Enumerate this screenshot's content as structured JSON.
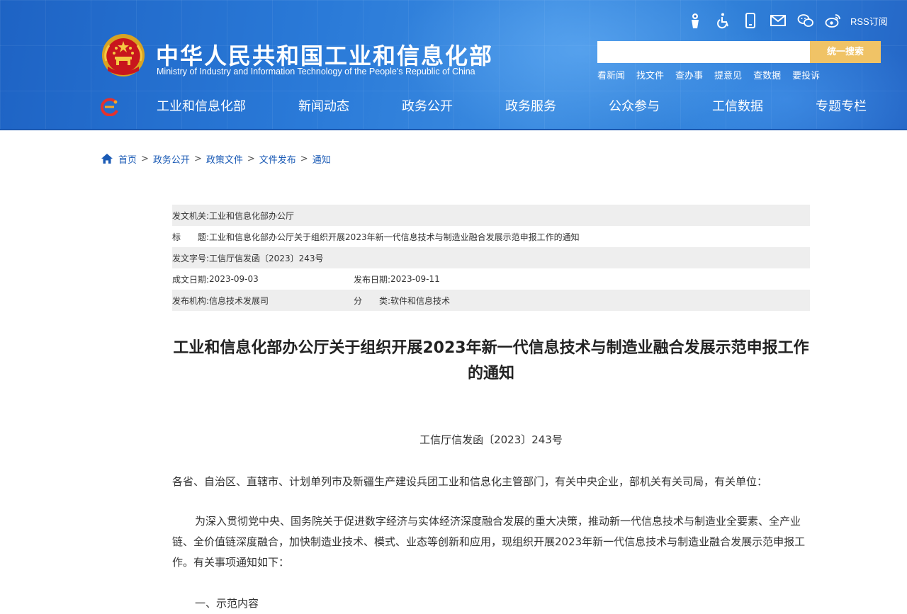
{
  "header": {
    "title_cn": "中华人民共和国工业和信息化部",
    "title_en": "Ministry of Industry and Information Technology of the People's Republic of China",
    "tools": [
      {
        "icon": "elder-mode-icon"
      },
      {
        "icon": "accessibility-icon"
      },
      {
        "icon": "mobile-icon"
      },
      {
        "icon": "mail-icon"
      },
      {
        "icon": "wechat-icon"
      },
      {
        "icon": "weibo-icon"
      }
    ],
    "rss_label": "RSS订阅",
    "search": {
      "placeholder": "",
      "button_label": "统一搜索"
    },
    "quick_links": [
      "看新闻",
      "找文件",
      "查办事",
      "提意见",
      "查数据",
      "要投诉"
    ],
    "nav": [
      "工业和信息化部",
      "新闻动态",
      "政务公开",
      "政务服务",
      "公众参与",
      "工信数据",
      "专题专栏"
    ]
  },
  "breadcrumb": [
    "首页",
    "政务公开",
    "政策文件",
    "文件发布",
    "通知"
  ],
  "breadcrumb_sep": ">",
  "meta": {
    "issuer_key": "发文机关:",
    "issuer": "工业和信息化部办公厅",
    "title_key": "标　　题:",
    "title": "工业和信息化部办公厅关于组织开展2023年新一代信息技术与制造业融合发展示范申报工作的通知",
    "doc_no_key": "发文字号:",
    "doc_no": "工信厅信发函〔2023〕243号",
    "created_key": "成文日期:",
    "created": "2023-09-03",
    "published_key": "发布日期:",
    "published": "2023-09-11",
    "org_key": "发布机构:",
    "org": "信息技术发展司",
    "category_key": "分　　类:",
    "category": "软件和信息技术"
  },
  "document": {
    "title": "工业和信息化部办公厅关于组织开展2023年新一代信息技术与制造业融合发展示范申报工作的通知",
    "number": "工信厅信发函〔2023〕243号",
    "addressee": "各省、自治区、直辖市、计划单列市及新疆生产建设兵团工业和信息化主管部门，有关中央企业，部机关有关司局，有关单位：",
    "intro": "为深入贯彻党中央、国务院关于促进数字经济与实体经济深度融合发展的重大决策，推动新一代信息技术与制造业全要素、全产业链、全价值链深度融合，加快制造业技术、模式、业态等创新和应用，现组织开展2023年新一代信息技术与制造业融合发展示范申报工作。有关事项通知如下：",
    "section1": "一、示范内容"
  },
  "colors": {
    "header_blue": "#2a7ad8",
    "search_button": "#f0c366",
    "link_blue": "#1a5ab5",
    "meta_shade": "#eeeeee"
  }
}
